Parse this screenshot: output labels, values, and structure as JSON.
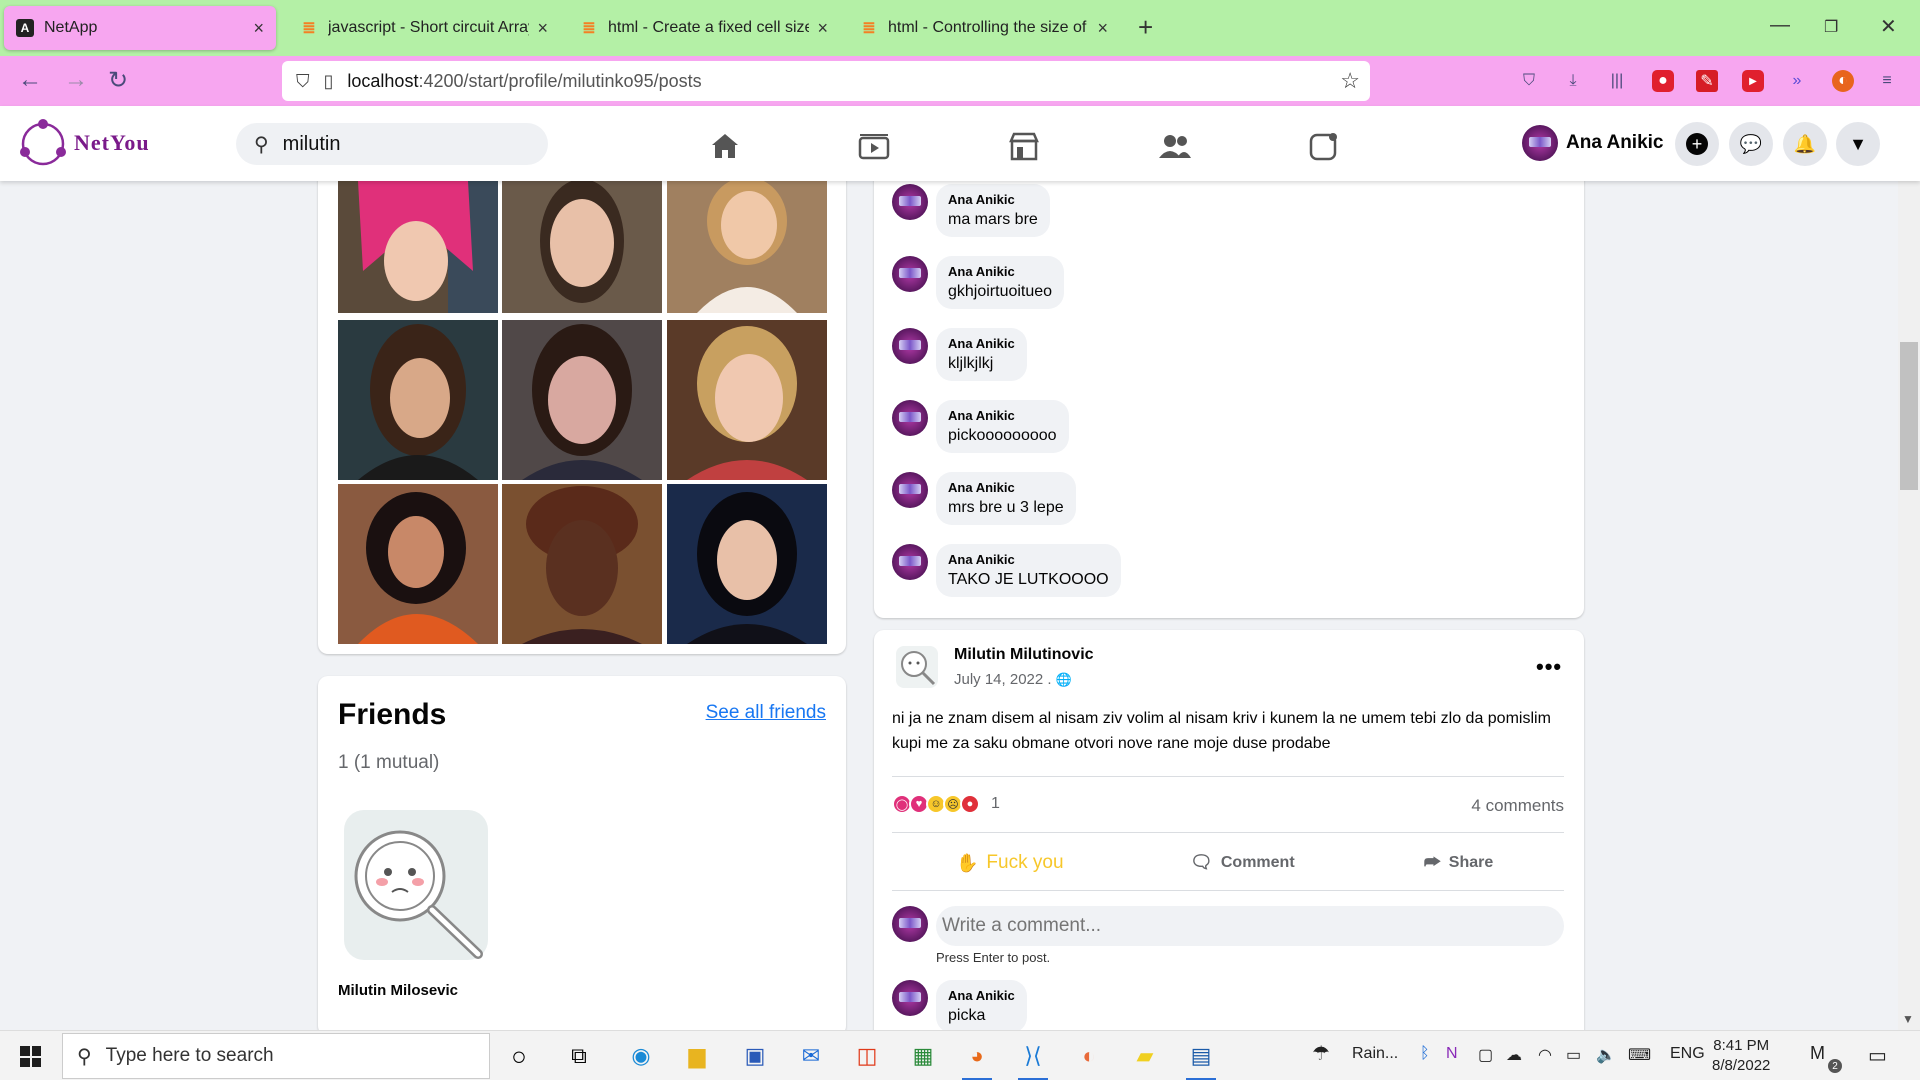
{
  "browser": {
    "tabs": [
      {
        "title": "NetApp",
        "favicon": "angular-icon",
        "active": true
      },
      {
        "title": "javascript - Short circuit Array.fo",
        "favicon": "stackoverflow-icon",
        "active": false
      },
      {
        "title": "html - Create a fixed cell size g",
        "favicon": "stackoverflow-icon",
        "active": false
      },
      {
        "title": "html - Controlling the size of an",
        "favicon": "stackoverflow-icon",
        "active": false
      }
    ],
    "url_host": "localhost",
    "url_path": ":4200/start/profile/milutinko95/posts",
    "colors": {
      "tabbar": "#b4f0a6",
      "navbar": "#f7a6f0"
    }
  },
  "app": {
    "logo_text": "NetYou",
    "search_value": "milutin",
    "user_name": "Ana Anikic",
    "accent": "#1877f2"
  },
  "friends": {
    "title": "Friends",
    "see_all": "See all friends",
    "count": "1 (1 mutual)",
    "list": [
      {
        "name": "Milutin Milosevic"
      }
    ]
  },
  "comments_top": [
    {
      "author": "Ana Anikic",
      "text": "ma mars bre"
    },
    {
      "author": "Ana Anikic",
      "text": "gkhjoirtuoitueo"
    },
    {
      "author": "Ana Anikic",
      "text": "kljlkjlkj"
    },
    {
      "author": "Ana Anikic",
      "text": "pickooooooooo"
    },
    {
      "author": "Ana Anikic",
      "text": "mrs bre u 3 lepe"
    },
    {
      "author": "Ana Anikic",
      "text": "TAKO JE LUTKOOOO"
    }
  ],
  "post": {
    "author": "Milutin Milutinovic",
    "date": "July 14, 2022 .",
    "text": "ni ja ne znam disem al nisam ziv volim al nisam kriv i kunem la ne umem tebi zlo da pomislim kupi me za saku obmane otvori nove rane moje duse prodabe",
    "reaction_count": "1",
    "comment_count": "4 comments",
    "actions": {
      "like": "Fuck you",
      "comment": "Comment",
      "share": "Share"
    },
    "comment_placeholder": "Write a comment...",
    "press_enter": "Press Enter to post.",
    "comments": [
      {
        "author": "Ana Anikic",
        "text": "picka"
      }
    ]
  },
  "taskbar": {
    "search_placeholder": "Type here to search",
    "weather": "Rain...",
    "lang": "ENG",
    "time": "8:41 PM",
    "date": "8/8/2022",
    "notification_badge": "2"
  }
}
